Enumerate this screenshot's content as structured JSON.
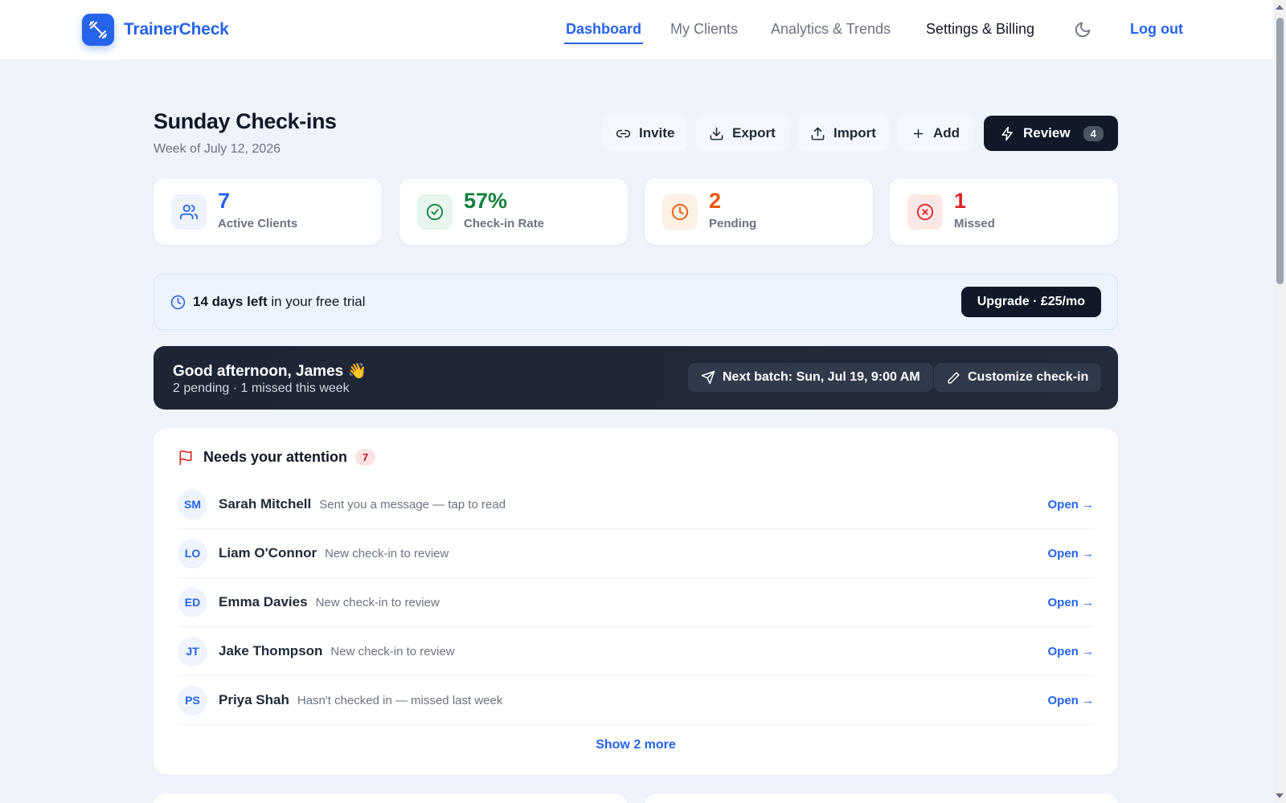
{
  "app": {
    "name": "TrainerCheck",
    "logo_icon": "dumbbell-icon",
    "brand_color": "#2563eb"
  },
  "nav": {
    "items": [
      {
        "label": "Dashboard",
        "active": true
      },
      {
        "label": "My Clients",
        "active": false
      },
      {
        "label": "Analytics & Trends",
        "active": false
      },
      {
        "label": "Settings & Billing",
        "active": false
      }
    ],
    "theme_toggle_icon": "moon-icon",
    "logout_label": "Log out"
  },
  "header": {
    "title": "Sunday Check-ins",
    "subtitle": "Week of July 12, 2026",
    "actions": [
      {
        "label": "Invite",
        "icon": "link-icon"
      },
      {
        "label": "Export",
        "icon": "download-icon"
      },
      {
        "label": "Import",
        "icon": "upload-icon"
      },
      {
        "label": "Add",
        "icon": "plus-icon"
      }
    ],
    "review": {
      "label": "Review",
      "count": "4",
      "icon": "lightning-icon"
    }
  },
  "stats": [
    {
      "value": "7",
      "label": "Active Clients",
      "icon": "users-icon",
      "color": "#2563eb",
      "bg": "#eef3fc"
    },
    {
      "value": "57%",
      "label": "Check-in Rate",
      "icon": "check-circle-icon",
      "color": "#15803d",
      "bg": "#e8f6ee"
    },
    {
      "value": "2",
      "label": "Pending",
      "icon": "clock-icon",
      "color": "#ea580c",
      "bg": "#fdf0e4"
    },
    {
      "value": "1",
      "label": "Missed",
      "icon": "x-circle-icon",
      "color": "#dc2626",
      "bg": "#fde8e8"
    }
  ],
  "trial": {
    "days_left": "14 days left",
    "rest": " in your free trial",
    "upgrade_label": "Upgrade · £25/mo"
  },
  "greeting": {
    "title": "Good afternoon, James",
    "emoji": "👋",
    "subtitle": "2 pending · 1 missed this week",
    "next_batch": "Next batch: Sun, Jul 19, 9:00 AM",
    "customize": "Customize check-in"
  },
  "attention": {
    "title": "Needs your attention",
    "count": "7",
    "items": [
      {
        "initials": "SM",
        "name": "Sarah Mitchell",
        "desc": "Sent you a message — tap to read",
        "action": "Open →"
      },
      {
        "initials": "LO",
        "name": "Liam O'Connor",
        "desc": "New check-in to review",
        "action": "Open →"
      },
      {
        "initials": "ED",
        "name": "Emma Davies",
        "desc": "New check-in to review",
        "action": "Open →"
      },
      {
        "initials": "JT",
        "name": "Jake Thompson",
        "desc": "New check-in to review",
        "action": "Open →"
      },
      {
        "initials": "PS",
        "name": "Priya Shah",
        "desc": "Hasn't checked in — missed last week",
        "action": "Open →"
      }
    ],
    "show_more": "Show 2 more"
  }
}
